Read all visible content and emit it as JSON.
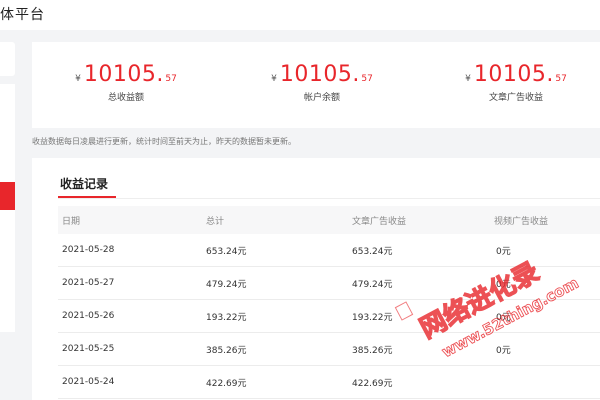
{
  "header": {
    "brand": "体平台"
  },
  "stats": [
    {
      "currency": "¥",
      "integer": "10105",
      "decimal": "57",
      "label": "总收益额"
    },
    {
      "currency": "¥",
      "integer": "10105",
      "decimal": "57",
      "label": "帐户余额"
    },
    {
      "currency": "¥",
      "integer": "10105",
      "decimal": "57",
      "label": "文章广告收益"
    }
  ],
  "notice": "收益数据每日凌晨进行更新，统计时间至前天为止，昨天的数据暂未更新。",
  "records": {
    "title": "收益记录",
    "columns": [
      "日期",
      "总计",
      "文章广告收益",
      "视频广告收益"
    ],
    "rows": [
      {
        "date": "2021-05-28",
        "total": "653.24元",
        "article": "653.24元",
        "video": "0元"
      },
      {
        "date": "2021-05-27",
        "total": "479.24元",
        "article": "479.24元",
        "video": "0元"
      },
      {
        "date": "2021-05-26",
        "total": "193.22元",
        "article": "193.22元",
        "video": "0元"
      },
      {
        "date": "2021-05-25",
        "total": "385.26元",
        "article": "385.26元",
        "video": "0元"
      },
      {
        "date": "2021-05-24",
        "total": "422.69元",
        "article": "422.69元",
        "video": ""
      }
    ]
  },
  "watermark": {
    "text_cn": "网络进化录",
    "text_url": "www.52thing.com"
  },
  "colors": {
    "accent": "#e8262b",
    "watermark": "#e8262b"
  }
}
